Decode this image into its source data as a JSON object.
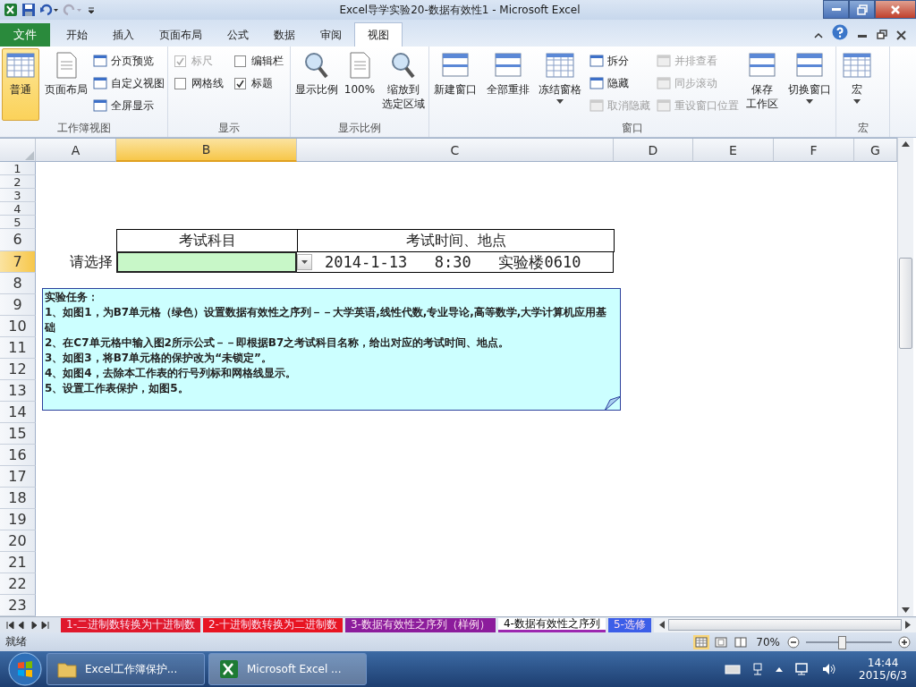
{
  "window": {
    "title": "Excel导学实验20-数据有效性1  -  Microsoft Excel"
  },
  "menu_tabs": [
    {
      "label": "文件",
      "kind": "file",
      "selected": false
    },
    {
      "label": "开始",
      "kind": "tab",
      "selected": false
    },
    {
      "label": "插入",
      "kind": "tab",
      "selected": false
    },
    {
      "label": "页面布局",
      "kind": "tab",
      "selected": false
    },
    {
      "label": "公式",
      "kind": "tab",
      "selected": false
    },
    {
      "label": "数据",
      "kind": "tab",
      "selected": false
    },
    {
      "label": "审阅",
      "kind": "tab",
      "selected": false
    },
    {
      "label": "视图",
      "kind": "tab",
      "selected": true
    }
  ],
  "ribbon": [
    {
      "label": "工作簿视图",
      "items": [
        {
          "kind": "large",
          "lines": [
            "普通"
          ],
          "selected": true,
          "dropdown": false
        },
        {
          "kind": "large",
          "lines": [
            "页面布局"
          ],
          "selected": false,
          "dropdown": false
        },
        {
          "kind": "column",
          "items": [
            {
              "kind": "small",
              "label": "分页预览",
              "disabled": false
            },
            {
              "kind": "small",
              "label": "自定义视图",
              "disabled": false
            },
            {
              "kind": "small",
              "label": "全屏显示",
              "disabled": false
            }
          ]
        }
      ]
    },
    {
      "label": "显示",
      "items": [
        {
          "kind": "column",
          "items": [
            {
              "kind": "check",
              "label": "标尺",
              "checked": true,
              "disabled": true
            },
            {
              "kind": "check",
              "label": "网格线",
              "checked": false,
              "disabled": false
            }
          ]
        },
        {
          "kind": "column",
          "items": [
            {
              "kind": "check",
              "label": "编辑栏",
              "checked": false,
              "disabled": false
            },
            {
              "kind": "check",
              "label": "标题",
              "checked": true,
              "disabled": false
            }
          ]
        }
      ]
    },
    {
      "label": "显示比例",
      "items": [
        {
          "kind": "large",
          "lines": [
            "显示比例"
          ],
          "selected": false,
          "dropdown": false
        },
        {
          "kind": "large",
          "lines": [
            "100%"
          ],
          "selected": false,
          "dropdown": false
        },
        {
          "kind": "large",
          "lines": [
            "缩放到",
            "选定区域"
          ],
          "selected": false,
          "dropdown": false
        }
      ]
    },
    {
      "label": "窗口",
      "items": [
        {
          "kind": "large",
          "lines": [
            "新建窗口"
          ],
          "selected": false,
          "dropdown": false
        },
        {
          "kind": "large",
          "lines": [
            "全部重排"
          ],
          "selected": false,
          "dropdown": false
        },
        {
          "kind": "large",
          "lines": [
            "冻结窗格"
          ],
          "selected": false,
          "dropdown": true
        },
        {
          "kind": "column",
          "items": [
            {
              "kind": "small",
              "label": "拆分",
              "disabled": false
            },
            {
              "kind": "small",
              "label": "隐藏",
              "disabled": false
            },
            {
              "kind": "small",
              "label": "取消隐藏",
              "disabled": true
            }
          ]
        },
        {
          "kind": "column",
          "items": [
            {
              "kind": "small",
              "label": "并排查看",
              "disabled": true
            },
            {
              "kind": "small",
              "label": "同步滚动",
              "disabled": true
            },
            {
              "kind": "small",
              "label": "重设窗口位置",
              "disabled": true
            }
          ]
        },
        {
          "kind": "large",
          "lines": [
            "保存",
            "工作区"
          ],
          "selected": false,
          "dropdown": false
        },
        {
          "kind": "large",
          "lines": [
            "切换窗口"
          ],
          "selected": false,
          "dropdown": true
        }
      ]
    },
    {
      "label": "宏",
      "items": [
        {
          "kind": "large",
          "lines": [
            "宏"
          ],
          "selected": false,
          "dropdown": true
        }
      ]
    }
  ],
  "sheet": {
    "columns": [
      {
        "label": "A",
        "selected": false
      },
      {
        "label": "B",
        "selected": true
      },
      {
        "label": "C",
        "selected": false
      },
      {
        "label": "D",
        "selected": false
      },
      {
        "label": "E",
        "selected": false
      },
      {
        "label": "F",
        "selected": false
      },
      {
        "label": "G",
        "selected": false
      }
    ],
    "rows": [
      {
        "label": "1",
        "selected": false
      },
      {
        "label": "2",
        "selected": false
      },
      {
        "label": "3",
        "selected": false
      },
      {
        "label": "4",
        "selected": false
      },
      {
        "label": "5",
        "selected": false
      },
      {
        "label": "6",
        "selected": false
      },
      {
        "label": "7",
        "selected": true
      },
      {
        "label": "8",
        "selected": false
      },
      {
        "label": "9",
        "selected": false
      },
      {
        "label": "10",
        "selected": false
      },
      {
        "label": "11",
        "selected": false
      },
      {
        "label": "12",
        "selected": false
      },
      {
        "label": "13",
        "selected": false
      },
      {
        "label": "14",
        "selected": false
      },
      {
        "label": "15",
        "selected": false
      },
      {
        "label": "16",
        "selected": false
      },
      {
        "label": "17",
        "selected": false
      },
      {
        "label": "18",
        "selected": false
      },
      {
        "label": "19",
        "selected": false
      },
      {
        "label": "20",
        "selected": false
      },
      {
        "label": "21",
        "selected": false
      },
      {
        "label": "22",
        "selected": false
      },
      {
        "label": "23",
        "selected": false
      }
    ],
    "form": {
      "headers": [
        "考试科目",
        "考试时间、地点"
      ],
      "row_label": "请选择",
      "input_selected": true,
      "result": "2014-1-13   8:30   实验楼0610"
    },
    "note": {
      "title": "实验任务：",
      "lines": [
        "1、如图1，为B7单元格（绿色）设置数据有效性之序列－－大学英语,线性代数,专业导论,高等数学,大学计算机应用基础",
        "2、在C7单元格中输入图2所示公式－－即根据B7之考试科目名称，给出对应的考试时间、地点。",
        "3、如图3，将B7单元格的保护改为“未锁定”。",
        "4、如图4，去除本工作表的行号列标和网格线显示。",
        "5、设置工作表保护，如图5。"
      ]
    }
  },
  "sheet_tabs": [
    {
      "label": "1-二进制数转换为十进制数",
      "color": "#e0182c",
      "selected": false
    },
    {
      "label": "2-十进制数转换为二进制数",
      "color": "#e81422",
      "selected": false
    },
    {
      "label": "3-数据有效性之序列（样例）",
      "color": "#8c1c9c",
      "selected": false
    },
    {
      "label": "4-数据有效性之序列",
      "color": "#9c27b0",
      "selected": true
    },
    {
      "label": "5-选修",
      "color": "#3c5ee8",
      "selected": false
    }
  ],
  "status_bar": {
    "status": "就绪",
    "zoom": "70%",
    "zoom_slider": {
      "level": 0.42
    }
  },
  "taskbar": {
    "items": [
      {
        "label": "Excel工作簿保护...",
        "kind": "folder",
        "selected": false
      },
      {
        "label": "Microsoft Excel ...",
        "kind": "excel",
        "selected": true
      }
    ],
    "time": "14:44",
    "date": "2015/6/3"
  }
}
